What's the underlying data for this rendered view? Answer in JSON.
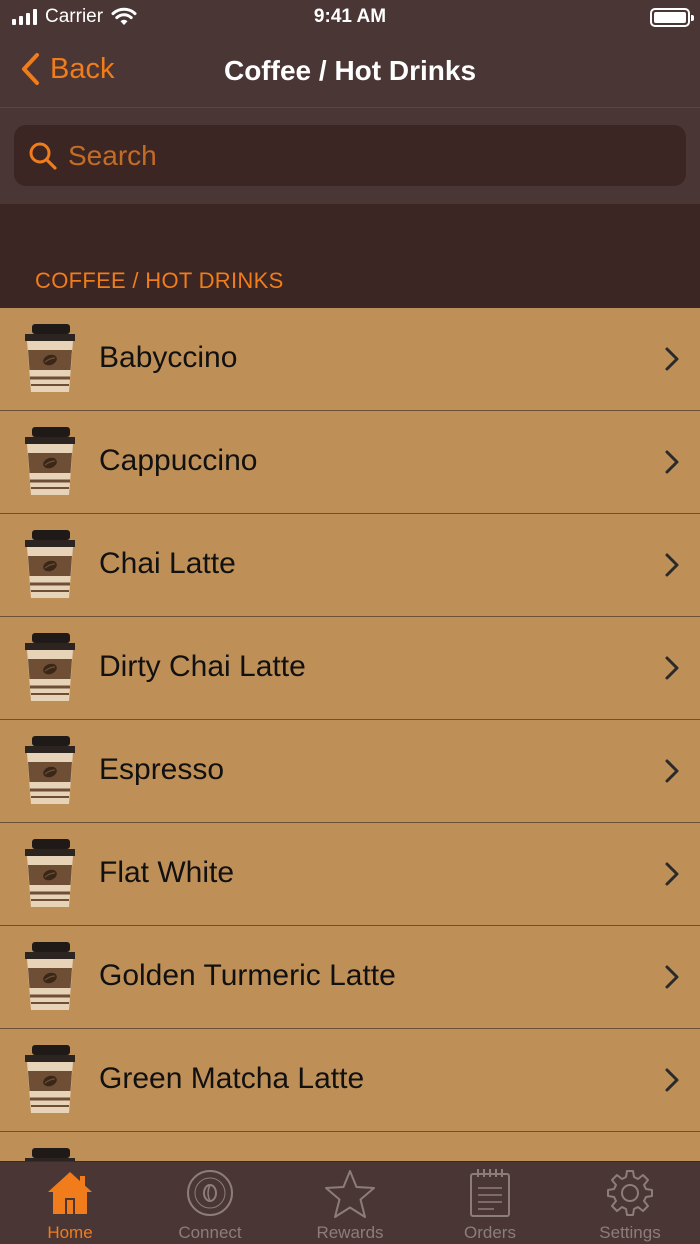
{
  "status_bar": {
    "carrier": "Carrier",
    "time": "9:41 AM"
  },
  "nav": {
    "back_label": "Back",
    "title": "Coffee / Hot Drinks"
  },
  "search": {
    "placeholder": "Search"
  },
  "section": {
    "title": "COFFEE / HOT DRINKS"
  },
  "items": [
    {
      "label": "Babyccino"
    },
    {
      "label": "Cappuccino"
    },
    {
      "label": "Chai Latte"
    },
    {
      "label": "Dirty Chai Latte"
    },
    {
      "label": "Espresso"
    },
    {
      "label": "Flat White"
    },
    {
      "label": "Golden Turmeric Latte"
    },
    {
      "label": "Green Matcha Latte"
    },
    {
      "label": ""
    }
  ],
  "tabs": [
    {
      "label": "Home",
      "icon": "home-icon",
      "active": true
    },
    {
      "label": "Connect",
      "icon": "bean-table-logo-icon",
      "active": false
    },
    {
      "label": "Rewards",
      "icon": "star-icon",
      "active": false
    },
    {
      "label": "Orders",
      "icon": "notepad-icon",
      "active": false
    },
    {
      "label": "Settings",
      "icon": "gear-icon",
      "active": false
    }
  ],
  "colors": {
    "accent": "#f07c1c",
    "background": "#4a3735",
    "section_header": "#3c2623",
    "list_row": "#be8f57",
    "inactive_tab": "#8c7d7a"
  }
}
